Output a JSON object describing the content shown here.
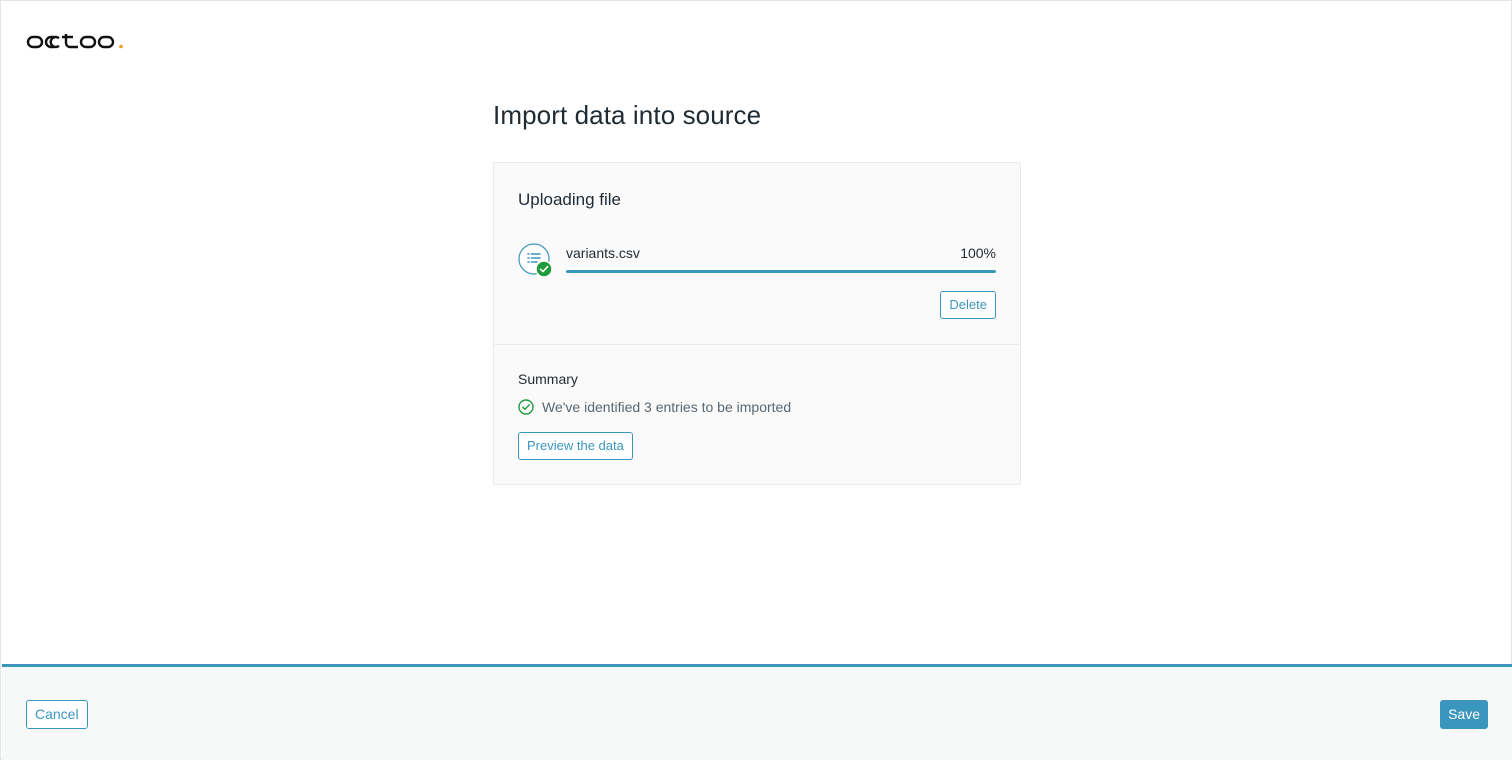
{
  "colors": {
    "accent": "#3b96bd",
    "success": "#1f9a3a",
    "text": "#1f2a33",
    "muted": "#5a6670"
  },
  "brand": {
    "logo_icon": "oceanlabs-wordmark-icon"
  },
  "page": {
    "title": "Import data into source"
  },
  "upload": {
    "section_title": "Uploading file",
    "file": {
      "icon": "list-file-icon",
      "status_icon": "check-circle-icon",
      "name": "variants.csv",
      "percent_label": "100%",
      "progress": 100
    },
    "delete_label": "Delete"
  },
  "summary": {
    "title": "Summary",
    "icon": "check-circle-outline-icon",
    "message": "We've identified 3 entries to be imported",
    "preview_label": "Preview the data"
  },
  "footer": {
    "cancel_label": "Cancel",
    "save_label": "Save"
  }
}
